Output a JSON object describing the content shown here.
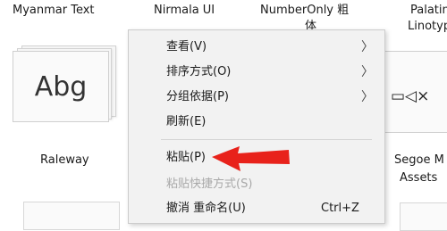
{
  "fonts_top": [
    "Myanmar Text",
    "Nirmala UI",
    "NumberOnly 粗",
    "Palatin"
  ],
  "fonts_top_line2": [
    "体",
    "Linotyp"
  ],
  "tile": {
    "preview": "Abg",
    "name": "Raleway"
  },
  "right_font": {
    "line1": "Segoe M",
    "line2": "Assets ",
    "glyphs": "▭◁×"
  },
  "context_menu": {
    "items": [
      {
        "label": "查看(V)",
        "has_submenu": true
      },
      {
        "label": "排序方式(O)",
        "has_submenu": true
      },
      {
        "label": "分组依据(P)",
        "has_submenu": true
      },
      {
        "label": "刷新(E)"
      },
      {
        "label": "粘贴(P)"
      },
      {
        "label": "粘贴快捷方式(S)",
        "disabled": true
      },
      {
        "label": "撤消 重命名(U)",
        "shortcut": "Ctrl+Z"
      }
    ],
    "submenu_arrow": "〉"
  },
  "annotation": {
    "color": "#e8221b"
  }
}
